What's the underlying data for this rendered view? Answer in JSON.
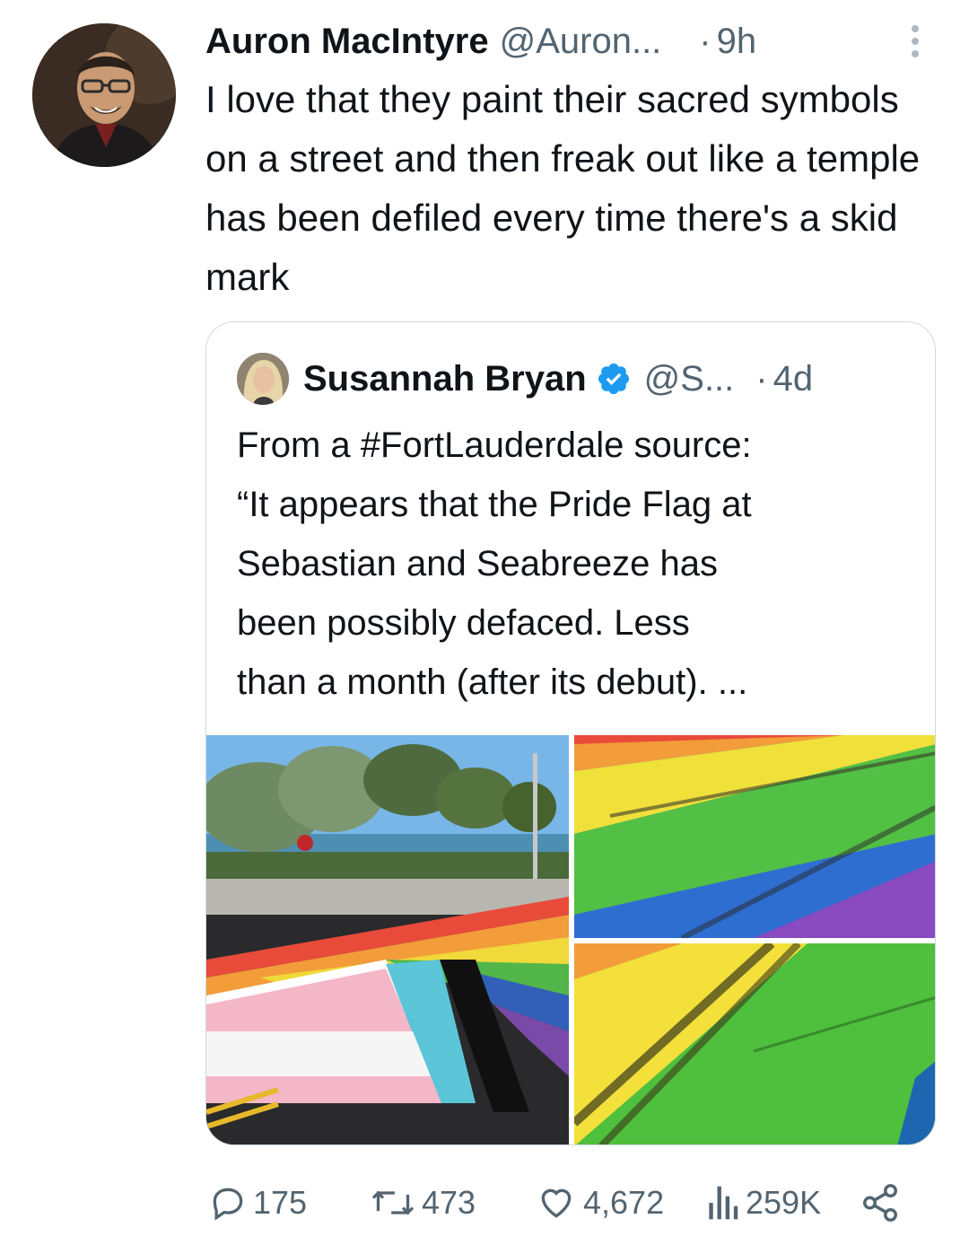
{
  "tweet": {
    "author_name": "Auron MacIntyre",
    "author_handle": "@Auron...",
    "separator": "·",
    "time": "9h",
    "text": "I love that they paint their sacred symbols on a street and then freak out like a temple has been defiled every time there's a skid mark"
  },
  "quoted_tweet": {
    "author_name": "Susannah Bryan",
    "author_handle": "@S...",
    "separator": "·",
    "time": "4d",
    "text_lines": [
      "From a #FortLauderdale source:",
      "“It appears that the Pride Flag at",
      "Sebastian and Seabreeze has",
      "been possibly defaced.  Less",
      "than a month (after its debut). ..."
    ]
  },
  "actions": {
    "replies": "175",
    "retweets": "473",
    "likes": "4,672",
    "views": "259K"
  },
  "icons": {
    "more": "more-vertical-icon",
    "verified": "verified-badge-icon",
    "reply": "reply-icon",
    "retweet": "retweet-icon",
    "like": "heart-icon",
    "views": "views-icon",
    "share": "share-icon"
  },
  "colors": {
    "text": "#0f1419",
    "secondary": "#536471",
    "border": "#cfd9de",
    "verified": "#1d9bf0"
  }
}
